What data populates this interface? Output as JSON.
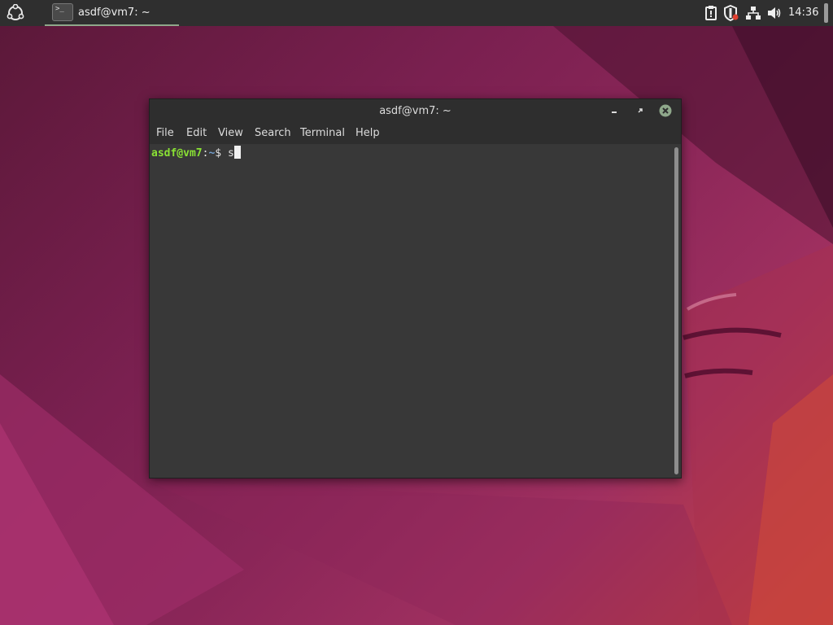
{
  "desktop": {
    "colors": {
      "accent": "#8fa88b",
      "terminal_bg": "#383838",
      "panel_bg": "#2f2f2f"
    }
  },
  "panel": {
    "menu_icon": "ubuntu-logo-icon",
    "task": {
      "label": "asdf@vm7: ~",
      "icon": "terminal-icon",
      "icon_glyph": ">_"
    },
    "tray": [
      "clipboard-icon",
      "shield-icon",
      "network-icon",
      "volume-icon"
    ],
    "clock": "14:36"
  },
  "window": {
    "title": "asdf@vm7: ~",
    "menu": [
      "File",
      "Edit",
      "View",
      "Search",
      "Terminal",
      "Help"
    ],
    "prompt": {
      "user_host": "asdf@vm7",
      "sep": ":",
      "path": "~",
      "symbol": "$ ",
      "input": "s"
    }
  }
}
